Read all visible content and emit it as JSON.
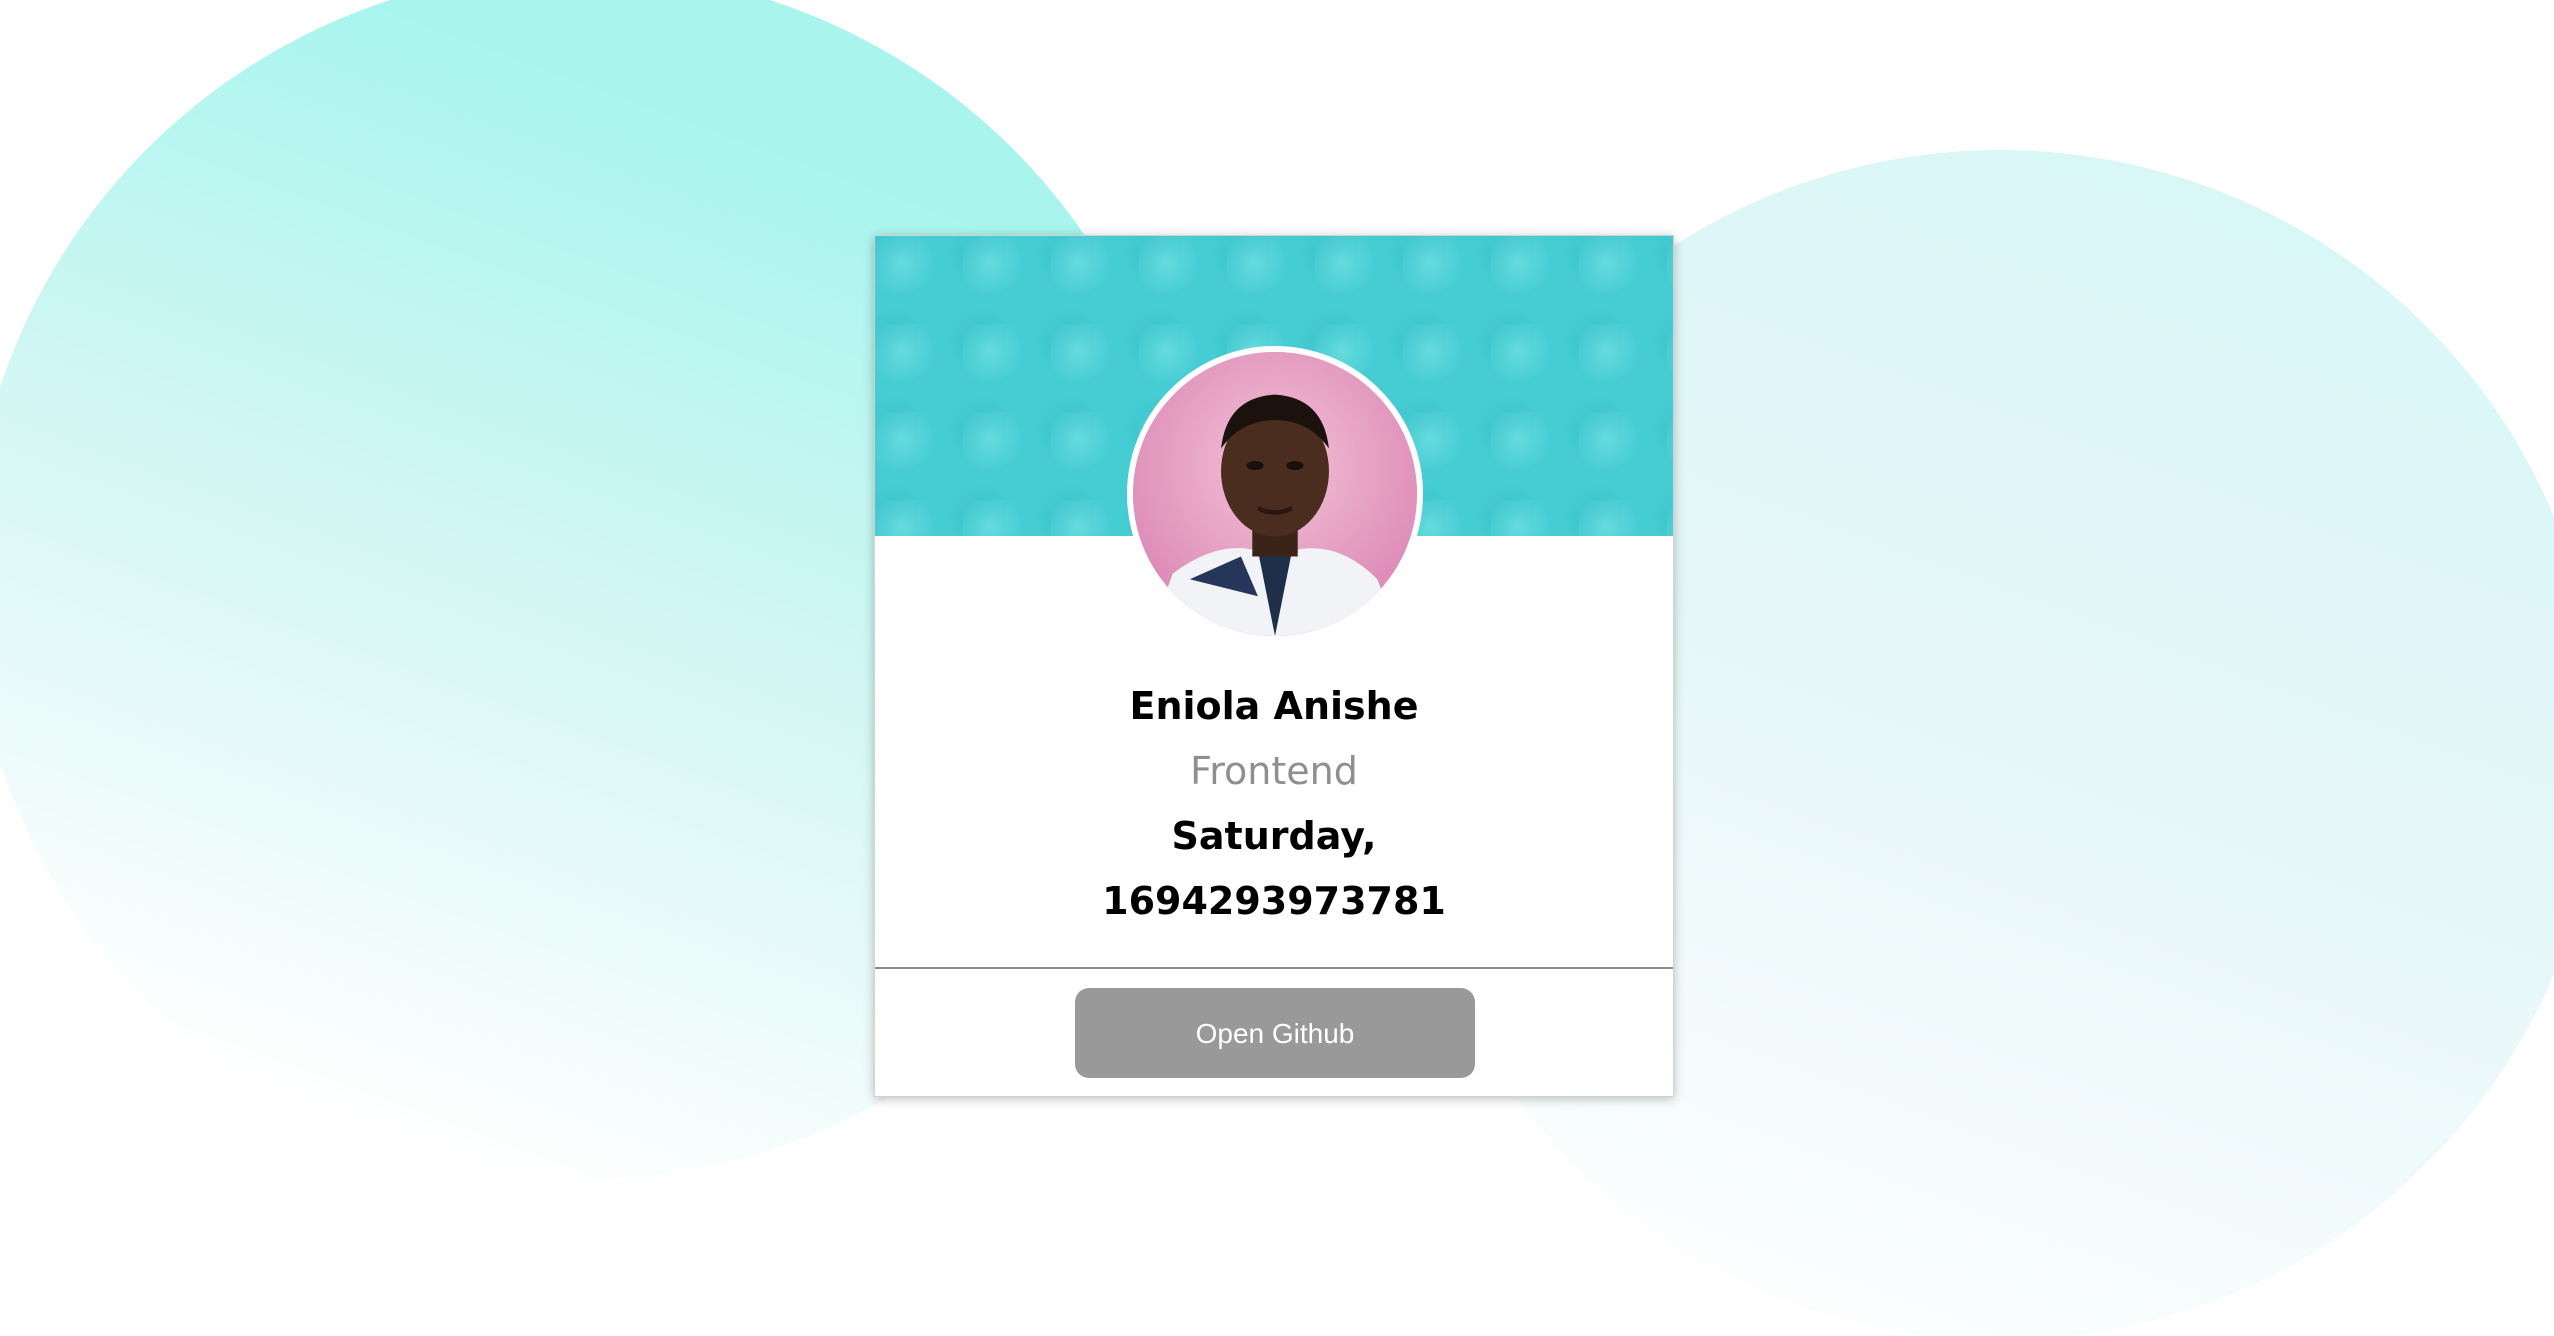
{
  "profile": {
    "name": "Eniola Anishe",
    "role": "Frontend",
    "day": "Saturday,",
    "timestamp": "1694293973781"
  },
  "actions": {
    "open_github_label": "Open Github"
  },
  "colors": {
    "banner": "#46ccd3",
    "button": "#999999",
    "role_text": "#8f8f8f",
    "blob_left": "#a9f5ee",
    "blob_right": "#d9f7f7"
  }
}
